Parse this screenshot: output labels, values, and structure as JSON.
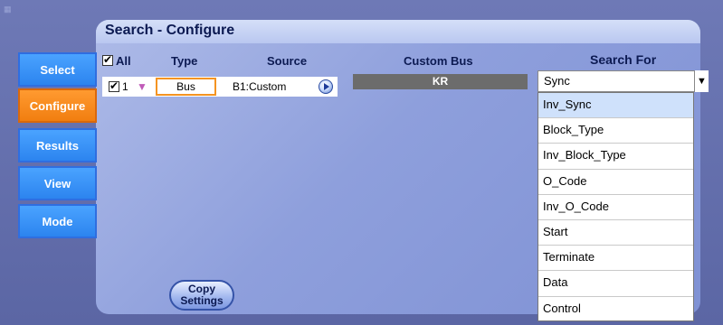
{
  "panel": {
    "title": "Search - Configure"
  },
  "tabs": [
    {
      "label": "Select"
    },
    {
      "label": "Configure"
    },
    {
      "label": "Results"
    },
    {
      "label": "View"
    },
    {
      "label": "Mode"
    }
  ],
  "table": {
    "all_label": "All",
    "headers": {
      "type": "Type",
      "source": "Source"
    },
    "row": {
      "index": "1",
      "type": "Bus",
      "source": "B1:Custom"
    }
  },
  "custom_bus": {
    "label": "Custom Bus",
    "value": "KR"
  },
  "search_for": {
    "label": "Search For",
    "selected": "Sync",
    "options": [
      "Inv_Sync",
      "Block_Type",
      "Inv_Block_Type",
      "O_Code",
      "Inv_O_Code",
      "Start",
      "Terminate",
      "Data",
      "Control"
    ]
  },
  "copy_settings": {
    "line1": "Copy",
    "line2": "Settings"
  },
  "colors": {
    "active_tab": "#f17e10",
    "tab": "#2c84ef",
    "panel_header": "#c6d2f4"
  }
}
